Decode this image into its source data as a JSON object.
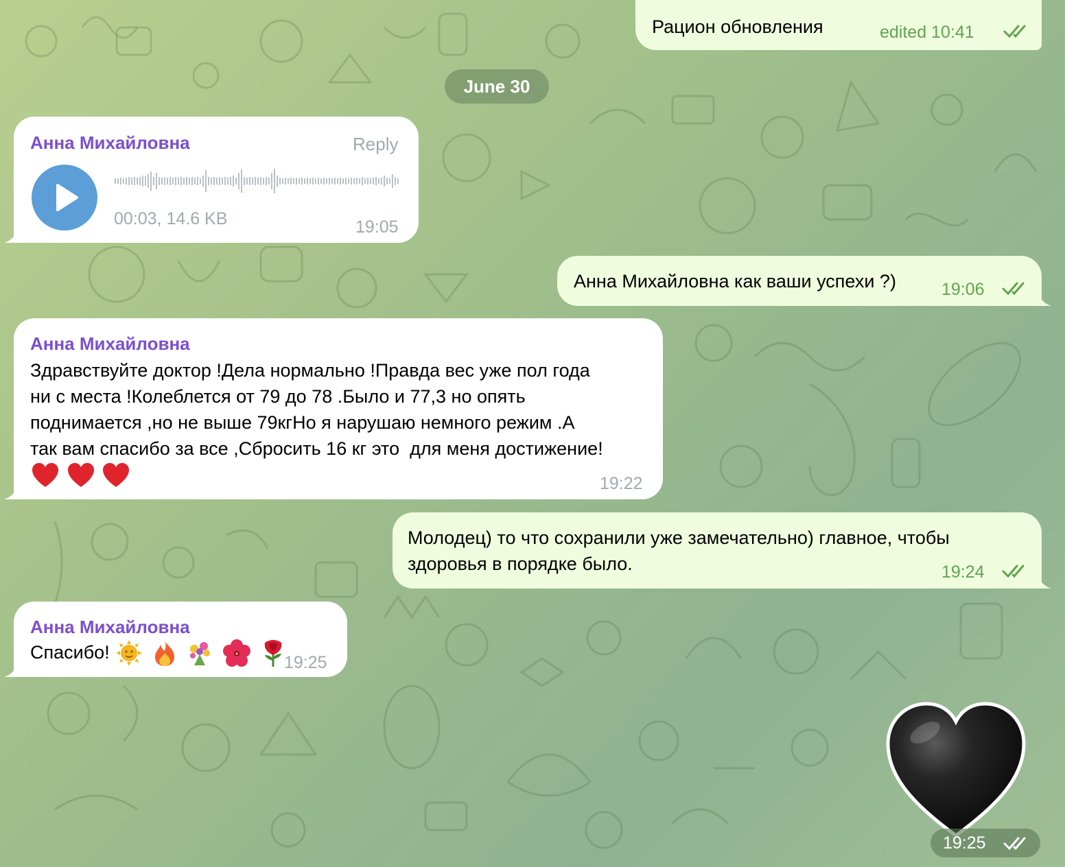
{
  "colors": {
    "sender_name": "#7b4fd1",
    "incoming_bubble": "#ffffff",
    "outgoing_bubble": "#effdde",
    "outgoing_time": "#5fa44e",
    "incoming_time": "#a3a8ad",
    "play_button": "#5b9ed8"
  },
  "messages": {
    "m0": {
      "text": "Рацион обновления",
      "time": "edited 10:41",
      "status_icon": "double-check-icon"
    },
    "date_separator": "June 30",
    "m1": {
      "sender": "Анна Михайловна",
      "reply_label": "Reply",
      "voice_meta": "00:03, 14.6 KB",
      "time": "19:05",
      "icons": [
        "play-icon",
        "waveform"
      ]
    },
    "m2": {
      "text": "Анна Михайловна как ваши успехи ?)",
      "time": "19:06",
      "status_icon": "double-check-icon"
    },
    "m3": {
      "sender": "Анна Михайловна",
      "line1": "Здравствуйте доктор !Дела нормально !Правда вес уже пол года",
      "line2": "ни с места !Колеблется от 79 до 78 .Было и 77,3 но опять",
      "line3": "поднимается ,но не выше 79кгНо я нарушаю немного режим .А",
      "line4": "так вам спасибо за все ,Сбросить 16 кг это  для меня достижение!",
      "emojis": [
        "red-heart",
        "red-heart",
        "red-heart"
      ],
      "time": "19:22"
    },
    "m4": {
      "line1": "Молодец) то что сохранили уже замечательно) главное, чтобы",
      "line2": "здоровья в порядке было.",
      "time": "19:24",
      "status_icon": "double-check-icon"
    },
    "m5": {
      "sender": "Анна Михайловна",
      "text": "Спасибо!",
      "emojis": [
        "sun-with-face",
        "fire",
        "bouquet",
        "hibiscus",
        "rose"
      ],
      "time": "19:25"
    },
    "m6": {
      "sticker": "black-heart",
      "time": "19:25",
      "status_icon": "double-check-icon"
    }
  }
}
